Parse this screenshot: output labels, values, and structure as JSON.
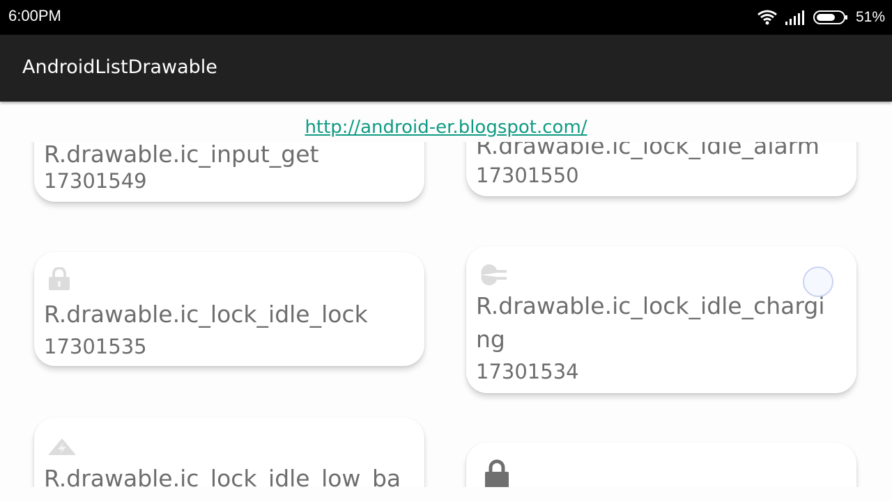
{
  "status_bar": {
    "time": "6:00PM",
    "battery_percent": "51%",
    "icons": [
      "wifi-icon",
      "signal-icon",
      "battery-icon"
    ]
  },
  "app_bar": {
    "title": "AndroidListDrawable"
  },
  "link": {
    "text": "http://android-er.blogspot.com/"
  },
  "items": [
    {
      "name": "R.drawable.ic_input_get",
      "id": "17301549",
      "icon": "none"
    },
    {
      "name": "R.drawable.ic_lock_idle_alarm",
      "id": "17301550",
      "icon": "none"
    },
    {
      "name": "R.drawable.ic_lock_idle_lock",
      "id": "17301535",
      "icon": "padlock-icon"
    },
    {
      "name": "R.drawable.ic_lock_idle_charging",
      "id": "17301534",
      "icon": "plug-icon"
    },
    {
      "name": "R.drawable.ic_lock_idle_low_ba",
      "id": "",
      "icon": "low-battery-icon"
    },
    {
      "name": "",
      "id": "",
      "icon": "padlock-icon"
    }
  ],
  "colors": {
    "status_bar": "#000000",
    "app_bar": "#212121",
    "link": "#0f9b83",
    "card_text": "#6d6d6d"
  }
}
